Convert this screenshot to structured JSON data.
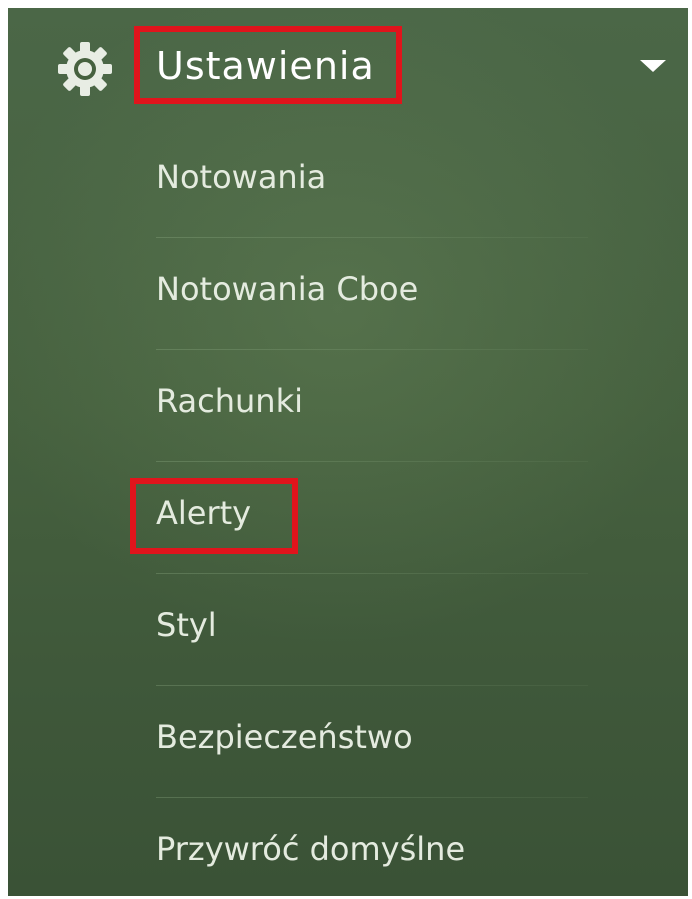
{
  "header": {
    "title": "Ustawienia",
    "icon": "gear-icon",
    "expand_icon": "chevron-down-icon"
  },
  "menu": {
    "items": [
      {
        "label": "Notowania"
      },
      {
        "label": "Notowania Cboe"
      },
      {
        "label": "Rachunki"
      },
      {
        "label": "Alerty"
      },
      {
        "label": "Styl"
      },
      {
        "label": "Bezpieczeństwo"
      },
      {
        "label": "Przywróć domyślne"
      }
    ]
  },
  "colors": {
    "background": "#46613f",
    "highlight_border": "#e0141c",
    "text": "#ffffff"
  }
}
